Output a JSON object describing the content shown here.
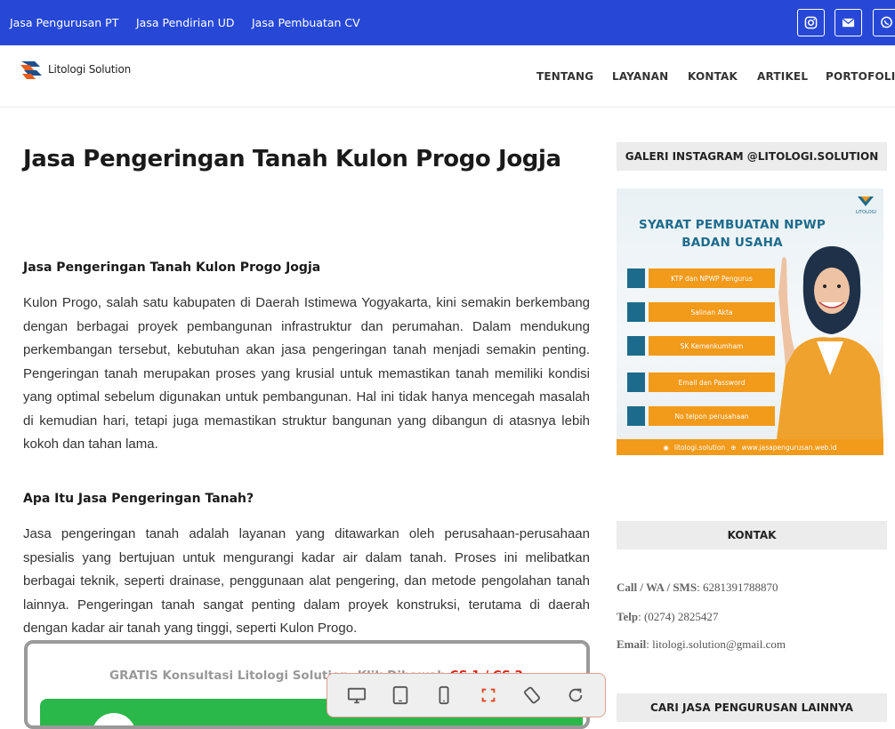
{
  "topbar": {
    "links": [
      "Jasa Pengurusan PT",
      "Jasa Pendirian UD",
      "Jasa Pembuatan CV"
    ],
    "social": [
      "instagram-icon",
      "envelope-icon",
      "whatsapp-icon"
    ],
    "bg_color": "#2748d6"
  },
  "nav": {
    "logo_text": "Litologi Solution",
    "items": [
      "TENTANG",
      "LAYANAN",
      "KONTAK",
      "ARTIKEL",
      "PORTOFOLIO"
    ]
  },
  "article": {
    "title": "Jasa Pengeringan Tanah Kulon Progo Jogja",
    "heading1": "Jasa Pengeringan Tanah Kulon Progo Jogja",
    "para1": "Kulon Progo, salah satu kabupaten di Daerah Istimewa Yogyakarta, kini semakin berkembang dengan berbagai proyek pembangunan infrastruktur dan perumahan. Dalam mendukung perkembangan tersebut, kebutuhan akan jasa pengeringan tanah menjadi semakin penting. Pengeringan tanah merupakan proses yang krusial untuk memastikan tanah memiliki kondisi yang optimal sebelum digunakan untuk pembangunan. Hal ini tidak hanya mencegah masalah di kemudian hari, tetapi juga memastikan struktur bangunan yang dibangun di atasnya lebih kokoh dan tahan lama.",
    "heading2": "Apa Itu Jasa Pengeringan Tanah?",
    "para2": "Jasa pengeringan tanah adalah layanan yang ditawarkan oleh perusahaan-perusahaan spesialis yang bertujuan untuk mengurangi kadar air dalam tanah. Proses ini melibatkan berbagai teknik, seperti drainase, penggunaan alat pengering, dan metode pengolahan tanah lainnya. Pengeringan tanah sangat penting dalam proyek konstruksi, terutama di daerah dengan kadar air tanah yang tinggi, seperti Kulon Progo.",
    "cta_text": "GRATIS Konsultasi Litologi Solution, Klik Dibawah ",
    "cta_red": "CS 1 / CS 2"
  },
  "sidebar": {
    "instagram_heading": "GALERI INSTAGRAM @LITOLOGI.SOLUTION",
    "ig_post": {
      "title_line1": "SYARAT PEMBUATAN NPWP",
      "title_line2": "BADAN USAHA",
      "brand": "LITOLOGI",
      "items": [
        "KTP dan NPWP Pengurus",
        "Salinan Akta",
        "SK Kemenkumham",
        "Email dan Password",
        "No telpon perusahaan"
      ],
      "footer_handle": "litologi.solution",
      "footer_site": "www.jasapengurusan.web.id"
    },
    "contact_heading": "KONTAK",
    "contact": {
      "phone_label": "Call / WA / SMS",
      "phone": "6281391788870",
      "tel_label": "Telp",
      "tel": "(0274) 2825427",
      "email_label": "Email",
      "email": "litologi.solution@gmail.com"
    },
    "search_heading": "CARI JASA PENGURUSAN LAINNYA"
  },
  "device_toolbar": {
    "buttons": [
      "desktop-icon",
      "tablet-icon",
      "mobile-icon",
      "fullscreen-icon",
      "rotate-icon",
      "reload-icon"
    ],
    "active_color": "#e0431f"
  }
}
